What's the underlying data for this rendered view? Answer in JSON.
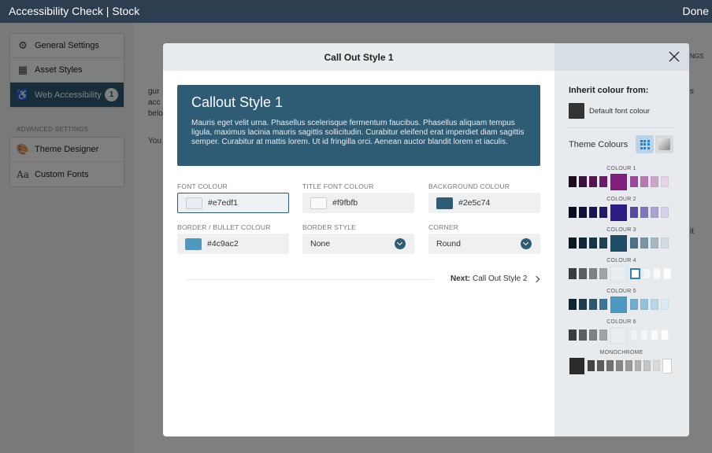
{
  "topbar": {
    "title": "Accessibility Check | Stock",
    "done_label": "Done"
  },
  "sidebar": {
    "items": [
      {
        "label": "General Settings"
      },
      {
        "label": "Asset Styles"
      },
      {
        "label": "Web Accessibility",
        "badge": "1"
      }
    ],
    "advanced_label": "ADVANCED SETTINGS",
    "advanced_items": [
      {
        "label": "Theme Designer"
      },
      {
        "label": "Custom Fonts"
      }
    ]
  },
  "background": {
    "lines": [
      "gur",
      "acc",
      "belo",
      "You"
    ],
    "right_text_1": "NGS",
    "right_text_2": "s",
    "right_text_3": "it"
  },
  "modal": {
    "title": "Call Out Style 1",
    "preview": {
      "heading": "Callout Style 1",
      "body": "Mauris eget velit urna. Phasellus scelerisque fermentum faucibus. Phasellus aliquam tempus ligula, maximus lacinia mauris sagittis sollicitudin. Curabitur eleifend erat imperdiet diam sagittis semper. Curabitur at mattis lorem. Ut id fringilla orci. Aenean auctor blandit lorem et iaculis."
    },
    "fields": {
      "font_colour": {
        "label": "FONT COLOUR",
        "value": "#e7edf1"
      },
      "title_font_colour": {
        "label": "TITLE FONT COLOUR",
        "value": "#f9fbfb"
      },
      "background_colour": {
        "label": "BACKGROUND COLOUR",
        "value": "#2e5c74"
      },
      "border_colour": {
        "label": "BORDER / BULLET COLOUR",
        "value": "#4c9ac2"
      },
      "border_style": {
        "label": "BORDER STYLE",
        "value": "None"
      },
      "corner": {
        "label": "CORNER",
        "value": "Round"
      }
    },
    "next": {
      "prefix": "Next:",
      "label": "Call Out Style 2"
    }
  },
  "side_panel": {
    "inherit_title": "Inherit colour from:",
    "default_label": "Default font colour",
    "default_colour": "#333333",
    "theme_label": "Theme Colours",
    "palettes": [
      {
        "label": "COLOUR 1",
        "colors": [
          "#1e0a1e",
          "#3c0f3c",
          "#551555",
          "#6b1b6b",
          "#811d7f",
          "#9b4b99",
          "#b679b4",
          "#cda6cc",
          "#e6d2e5"
        ],
        "selected": 4
      },
      {
        "label": "COLOUR 2",
        "colors": [
          "#0c0a22",
          "#13103a",
          "#1a1452",
          "#22196a",
          "#2d1c85",
          "#574aa0",
          "#8077b8",
          "#aaa3d0",
          "#d4d1e8"
        ],
        "selected": 4
      },
      {
        "label": "COLOUR 3",
        "colors": [
          "#0a1a22",
          "#10283a",
          "#163546",
          "#1c4256",
          "#1f4e68",
          "#4b7286",
          "#7896a6",
          "#a5b9c3",
          "#d2dce1"
        ],
        "selected": 4
      },
      {
        "label": "COLOUR 4",
        "colors": [
          "#3a3c3e",
          "#5c5f62",
          "#7e8285",
          "#a0a4a7",
          "#e7edf1",
          "#ffffff",
          "#f3f5f7",
          "#f8fafb",
          "#ffffff"
        ],
        "selected": 4,
        "highlight": 5
      },
      {
        "label": "COLOUR 5",
        "colors": [
          "#0f2733",
          "#1e3e50",
          "#2d5970",
          "#3c7599",
          "#4c9ac2",
          "#70aecf",
          "#93c2db",
          "#b7d7e7",
          "#dbebf3"
        ],
        "selected": 4
      },
      {
        "label": "COLOUR 6",
        "colors": [
          "#3a3c3e",
          "#5c5f62",
          "#7e8285",
          "#a0a4a7",
          "#e7edf1",
          "#eef3f6",
          "#f3f6f8",
          "#f7f9fb",
          "#fcfdfd"
        ],
        "selected": 4
      },
      {
        "label": "MONOCHROME",
        "colors": [
          "#2b2b2b",
          "#444444",
          "#5c5c5c",
          "#717171",
          "#868686",
          "#9b9b9b",
          "#b0b0b0",
          "#c5c5c5",
          "#dadada",
          "#ffffff"
        ],
        "selected": 0,
        "last_big": true
      }
    ]
  }
}
